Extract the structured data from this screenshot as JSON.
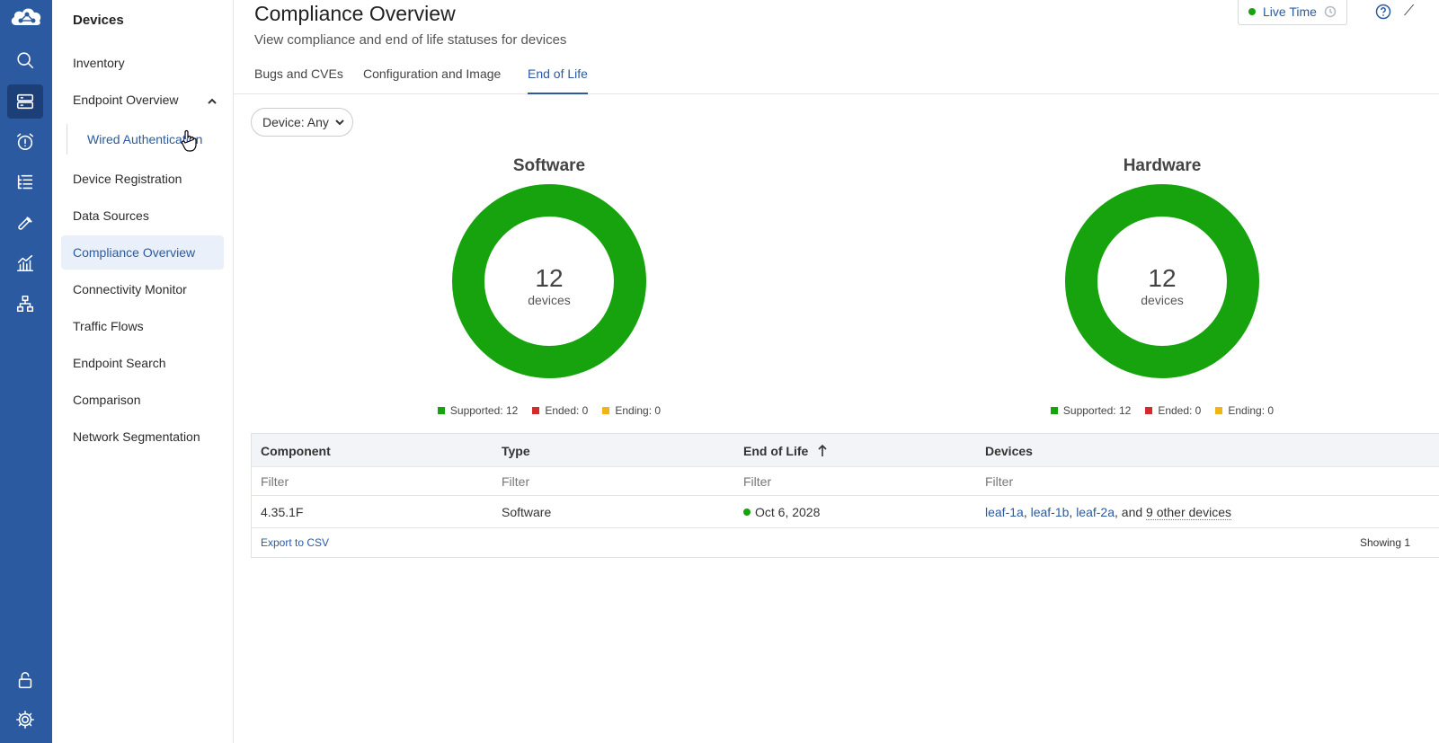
{
  "rail": {
    "items": [
      {
        "name": "search",
        "icon": "search-icon"
      },
      {
        "name": "devices",
        "icon": "server-icon",
        "active": true
      },
      {
        "name": "events",
        "icon": "alarm-icon"
      },
      {
        "name": "provisioning",
        "icon": "list-tree-icon"
      },
      {
        "name": "tools",
        "icon": "wrench-icon"
      },
      {
        "name": "metrics",
        "icon": "chart-icon"
      },
      {
        "name": "topology",
        "icon": "network-icon"
      },
      {
        "name": "lock",
        "icon": "unlock-icon"
      },
      {
        "name": "settings",
        "icon": "gear-icon"
      }
    ]
  },
  "nav": {
    "title": "Devices",
    "items": {
      "inventory": "Inventory",
      "endpoint_overview": "Endpoint Overview",
      "wired_auth": "Wired Authentication",
      "device_registration": "Device Registration",
      "data_sources": "Data Sources",
      "compliance_overview": "Compliance Overview",
      "connectivity_monitor": "Connectivity Monitor",
      "traffic_flows": "Traffic Flows",
      "endpoint_search": "Endpoint Search",
      "comparison": "Comparison",
      "network_segmentation": "Network Segmentation"
    }
  },
  "header": {
    "title": "Compliance Overview",
    "subtitle": "View compliance and end of life statuses for devices",
    "live_label": "Live Time"
  },
  "tabs": {
    "bugs": "Bugs and CVEs",
    "config": "Configuration and Image",
    "eol": "End of Life"
  },
  "filter": {
    "device_label": "Device: Any"
  },
  "donuts": {
    "software": {
      "title": "Software",
      "count": "12",
      "unit": "devices",
      "supported": "Supported: 12",
      "ended": "Ended: 0",
      "ending": "Ending: 0"
    },
    "hardware": {
      "title": "Hardware",
      "count": "12",
      "unit": "devices",
      "supported": "Supported: 12",
      "ended": "Ended: 0",
      "ending": "Ending: 0"
    }
  },
  "colors": {
    "supported": "#16a30e",
    "ended": "#d42a2a",
    "ending": "#f0b418",
    "accent": "#2c5aa0"
  },
  "table": {
    "columns": {
      "component": "Component",
      "type": "Type",
      "eol": "End of Life",
      "devices": "Devices"
    },
    "filter_placeholder": "Filter",
    "row": {
      "component": "4.35.1F",
      "type": "Software",
      "eol": "Oct 6, 2028",
      "dev1": "leaf-1a",
      "dev2": "leaf-1b",
      "dev3": "leaf-2a",
      "and": "and",
      "others": "9 other devices"
    },
    "export": "Export to CSV",
    "showing": "Showing 1"
  }
}
